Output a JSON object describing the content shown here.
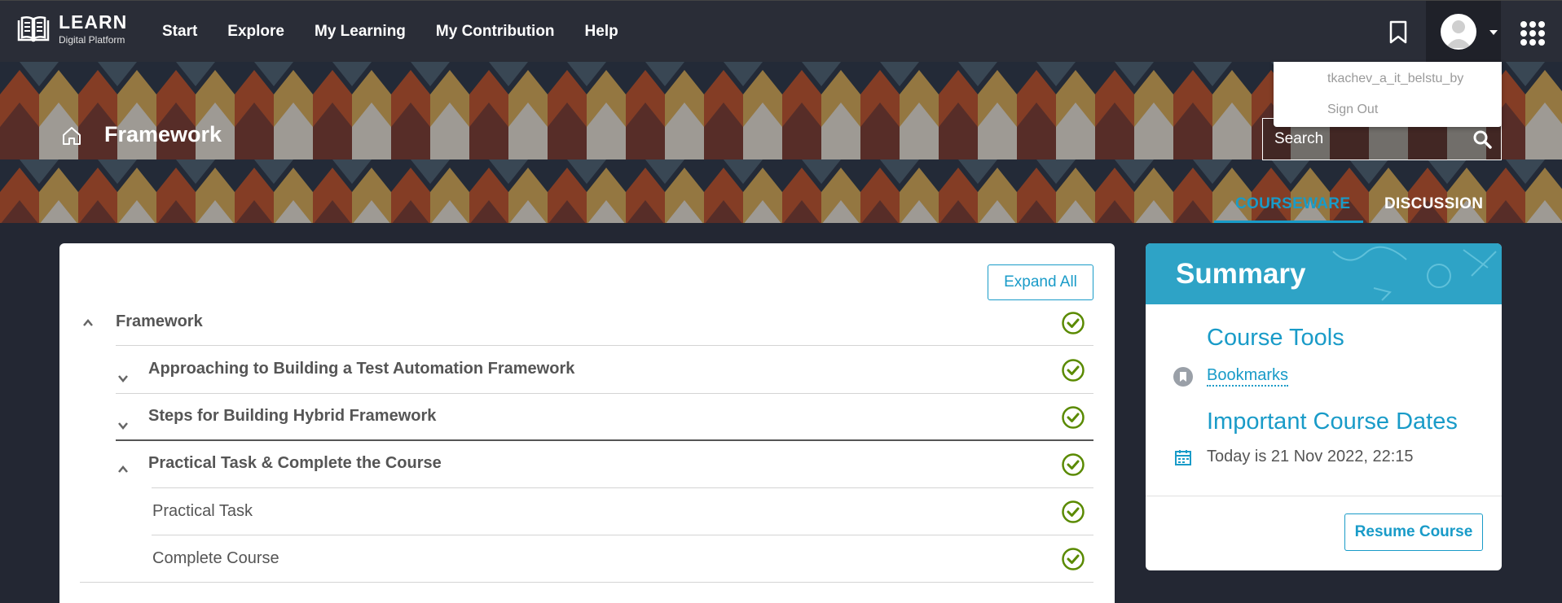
{
  "brand": {
    "title": "LEARN",
    "subtitle": "Digital Platform"
  },
  "nav": {
    "items": [
      "Start",
      "Explore",
      "My Learning",
      "My Contribution",
      "Help"
    ]
  },
  "user_menu": {
    "username": "tkachev_a_it_belstu_by",
    "sign_out": "Sign Out"
  },
  "header": {
    "title": "Framework",
    "search_placeholder": "Search"
  },
  "tabs": {
    "courseware": "COURSEWARE",
    "discussion": "DISCUSSION"
  },
  "outline": {
    "expand_all": "Expand All",
    "section": "Framework",
    "subsections": [
      "Approaching to Building a Test Automation Framework",
      "Steps for Building Hybrid Framework",
      "Practical Task & Complete the Course"
    ],
    "units": [
      "Practical Task",
      "Complete Course"
    ]
  },
  "summary": {
    "title": "Summary",
    "tools_heading": "Course Tools",
    "bookmarks": "Bookmarks",
    "dates_heading": "Important Course Dates",
    "today": "Today is 21 Nov 2022, 22:15",
    "resume": "Resume Course"
  },
  "colors": {
    "accent": "#199bc8",
    "check": "#5a8a00",
    "navbar": "#2a2d37",
    "page_bg": "#232733"
  },
  "icons": [
    "book-logo-icon",
    "bookmark-icon",
    "avatar-icon",
    "caret-down-icon",
    "apps-grid-icon",
    "home-icon",
    "search-icon",
    "chevron-up-icon",
    "chevron-down-icon",
    "check-circle-icon",
    "calendar-icon"
  ]
}
